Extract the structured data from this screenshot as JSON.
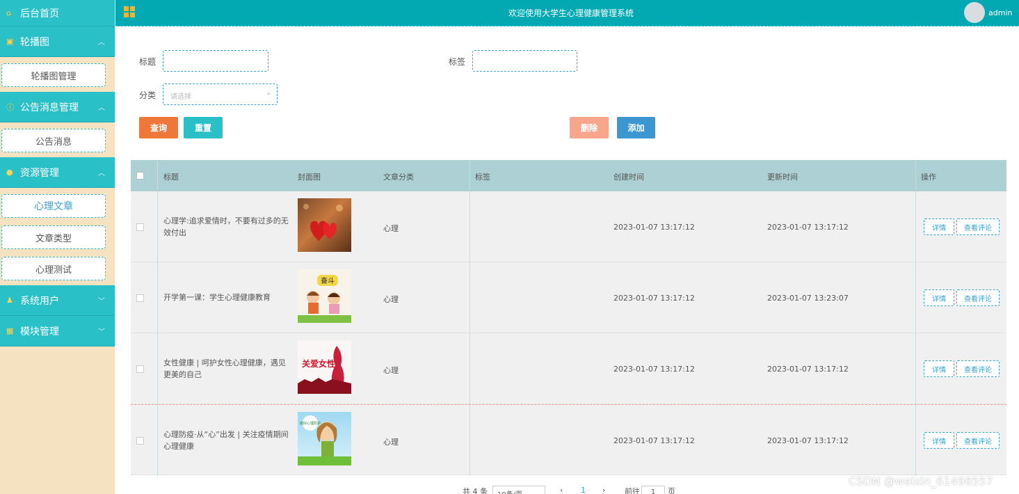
{
  "topbar": {
    "title": "欢迎使用大学生心理健康管理系统",
    "user": "admin"
  },
  "sidebar": {
    "home": "后台首页",
    "groups": [
      {
        "icon": "image-icon",
        "label": "轮播图",
        "items": [
          "轮播图管理"
        ]
      },
      {
        "icon": "info-icon",
        "label": "公告消息管理",
        "items": [
          "公告消息"
        ]
      },
      {
        "icon": "location-icon",
        "label": "资源管理",
        "items": [
          "心理文章",
          "文章类型",
          "心理测试"
        ]
      },
      {
        "icon": "user-icon",
        "label": "系统用户",
        "items": []
      },
      {
        "icon": "grid-icon",
        "label": "模块管理",
        "items": []
      }
    ]
  },
  "search": {
    "title_label": "标题",
    "tag_label": "标签",
    "category_label": "分类",
    "category_placeholder": "请选择",
    "query_button": "查询",
    "reset_button": "重置",
    "delete_button": "删除",
    "add_button": "添加"
  },
  "colors": {
    "accent": "#29c0c8",
    "header": "#03a9b2",
    "query": "#f0773a",
    "reset": "#29c0c8",
    "delete": "#f7a58b",
    "add": "#3c96d0",
    "sidebar_bg": "#f4e2c0"
  },
  "table": {
    "columns": [
      "标题",
      "封面图",
      "文章分类",
      "标签",
      "创建时间",
      "更新时间",
      "操作"
    ],
    "rows": [
      {
        "title": "心理学:追求爱情时，不要有过多的无效付出",
        "category": "心理",
        "tag": "",
        "created": "2023-01-07 13:17:12",
        "updated": "2023-01-07 13:17:12"
      },
      {
        "title": "开学第一课：学生心理健康教育",
        "category": "心理",
        "tag": "",
        "created": "2023-01-07 13:17:12",
        "updated": "2023-01-07 13:23:07"
      },
      {
        "title": "女性健康 | 呵护女性心理健康，遇见更美的自己",
        "category": "心理",
        "tag": "",
        "created": "2023-01-07 13:17:12",
        "updated": "2023-01-07 13:17:12"
      },
      {
        "title": "心理防疫·从“心”出发 | 关注疫情期间心理健康",
        "category": "心理",
        "tag": "",
        "created": "2023-01-07 13:17:12",
        "updated": "2023-01-07 13:17:12"
      }
    ],
    "detail_button": "详情",
    "comments_button": "查看评论",
    "cover_texts": [
      "奋斗",
      "关爱女性",
      "做好心理防护"
    ]
  },
  "pager": {
    "total": "共 4 条",
    "page_size": "10条/页",
    "page": "1",
    "goto": "前往",
    "page_unit": "页"
  },
  "watermark": "CSDN @weixin_61498557"
}
